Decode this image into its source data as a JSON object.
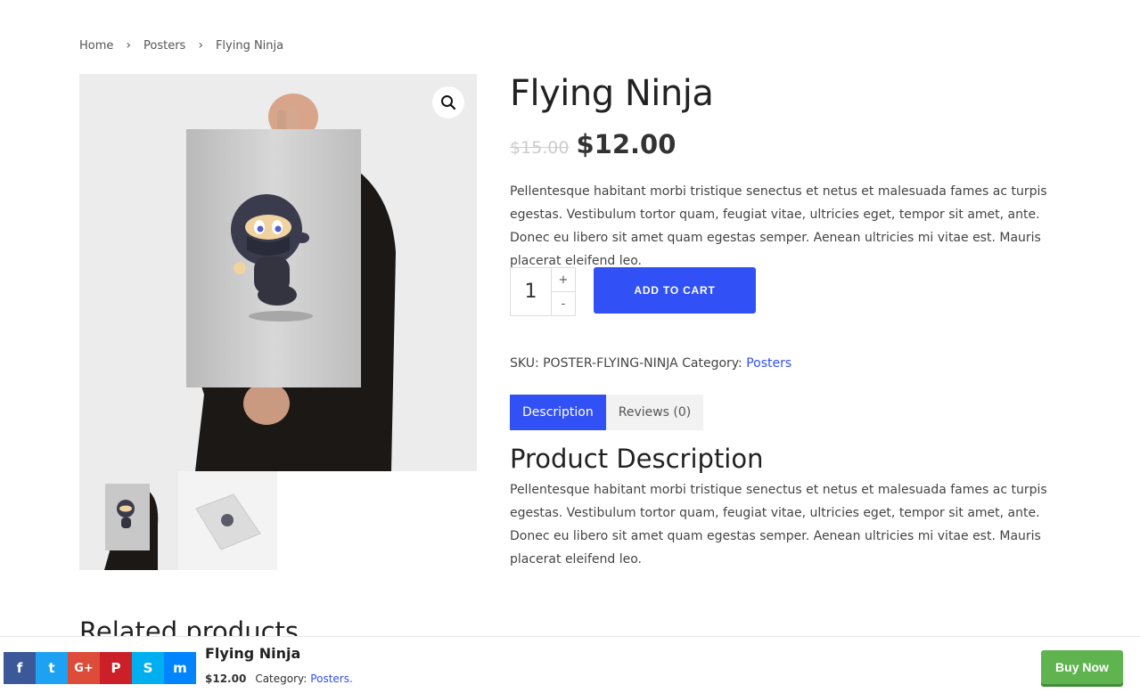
{
  "breadcrumb": {
    "home": "Home",
    "category": "Posters",
    "current": "Flying Ninja"
  },
  "product": {
    "title": "Flying Ninja",
    "price_old": "$15.00",
    "price_new": "$12.00",
    "short_description": "Pellentesque habitant morbi tristique senectus et netus et malesuada fames ac turpis egestas. Vestibulum tortor quam, feugiat vitae, ultricies eget, tempor sit amet, ante. Donec eu libero sit amet quam egestas semper. Aenean ultricies mi vitae est. Mauris placerat eleifend leo.",
    "quantity": "1",
    "qty_plus": "+",
    "qty_minus": "-",
    "add_to_cart": "ADD TO CART",
    "sku_label": "SKU:",
    "sku": "POSTER-FLYING-NINJA",
    "category_label": "Category:",
    "category": "Posters"
  },
  "tabs": [
    {
      "label": "Description",
      "active": true
    },
    {
      "label": "Reviews (0)",
      "active": false
    }
  ],
  "description": {
    "heading": "Product Description",
    "body": "Pellentesque habitant morbi tristique senectus et netus et malesuada fames ac turpis egestas. Vestibulum tortor quam, feugiat vitae, ultricies eget, tempor sit amet, ante. Donec eu libero sit amet quam egestas semper. Aenean ultricies mi vitae est. Mauris placerat eleifend leo."
  },
  "related_heading": "Related products",
  "sticky": {
    "title": "Flying Ninja",
    "price": "$12.00",
    "category_label": "Category:",
    "category": "Posters.",
    "buy_now": "Buy Now",
    "share_buttons": [
      {
        "icon": "facebook-icon",
        "glyph": "f",
        "color": "#3b5998"
      },
      {
        "icon": "twitter-icon",
        "glyph": "t",
        "color": "#1da1f2"
      },
      {
        "icon": "google-plus-icon",
        "glyph": "G+",
        "color": "#dd4b39"
      },
      {
        "icon": "pinterest-icon",
        "glyph": "P",
        "color": "#cb2027"
      },
      {
        "icon": "skype-icon",
        "glyph": "S",
        "color": "#00aff0"
      },
      {
        "icon": "messenger-icon",
        "glyph": "m",
        "color": "#0084ff"
      }
    ]
  },
  "colors": {
    "accent": "#3150f5",
    "buy_now": "#5fb44f"
  }
}
